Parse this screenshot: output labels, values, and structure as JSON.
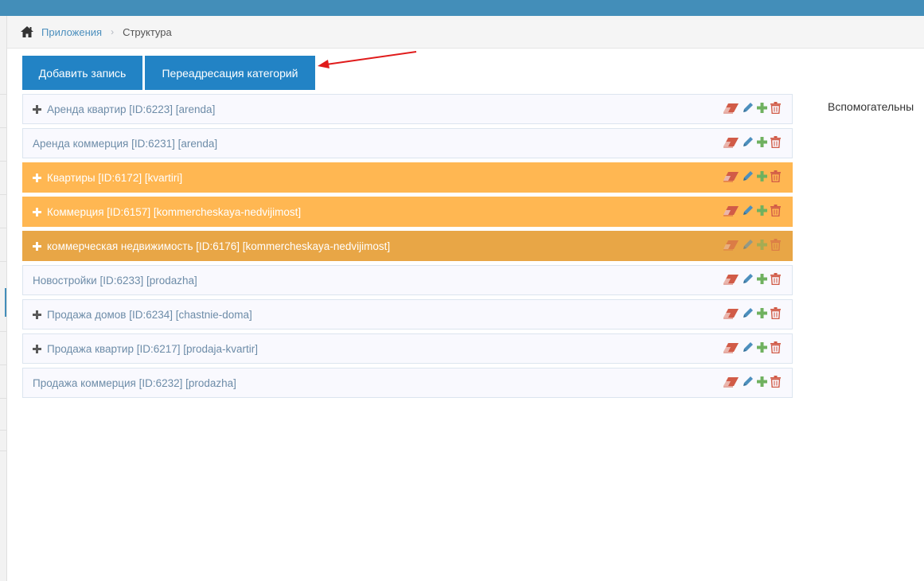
{
  "breadcrumbs": {
    "home_icon": "home-icon",
    "items": [
      "Приложения"
    ],
    "current": "Структура"
  },
  "toolbar": {
    "add_label": "Добавить запись",
    "redirect_label": "Переадресация категорий"
  },
  "side_note": "Вспомогательны",
  "colors": {
    "header": "#438eb9",
    "button": "#2283c5",
    "row_highlight": "#ffb752",
    "row_highlight_dark": "#e8a646",
    "icon_erase": "#d15b47",
    "icon_edit": "#4c8fbd",
    "icon_add": "#87b87f",
    "icon_delete": "#d15b47",
    "annotation_arrow": "#e01b1b"
  },
  "categories": [
    {
      "label": "Аренда квартир [ID:6223] [arenda]"
    },
    {
      "label": "Аренда коммерция [ID:6231] [arenda]"
    },
    {
      "label": "Квартиры [ID:6172] [kvartiri]"
    },
    {
      "label": "Коммерция [ID:6157] [kommercheskaya-nedvijimost]"
    },
    {
      "label": "коммерческая недвижимость [ID:6176] [kommercheskaya-nedvijimost]"
    },
    {
      "label": "Новостройки [ID:6233] [prodazha]"
    },
    {
      "label": "Продажа домов [ID:6234] [chastnie-doma]"
    },
    {
      "label": "Продажа квартир [ID:6217] [prodaja-kvartir]"
    },
    {
      "label": "Продажа коммерция [ID:6232] [prodazha]"
    }
  ],
  "row_icons": [
    "eraser-icon",
    "pencil-icon",
    "plus-icon",
    "trash-icon"
  ]
}
